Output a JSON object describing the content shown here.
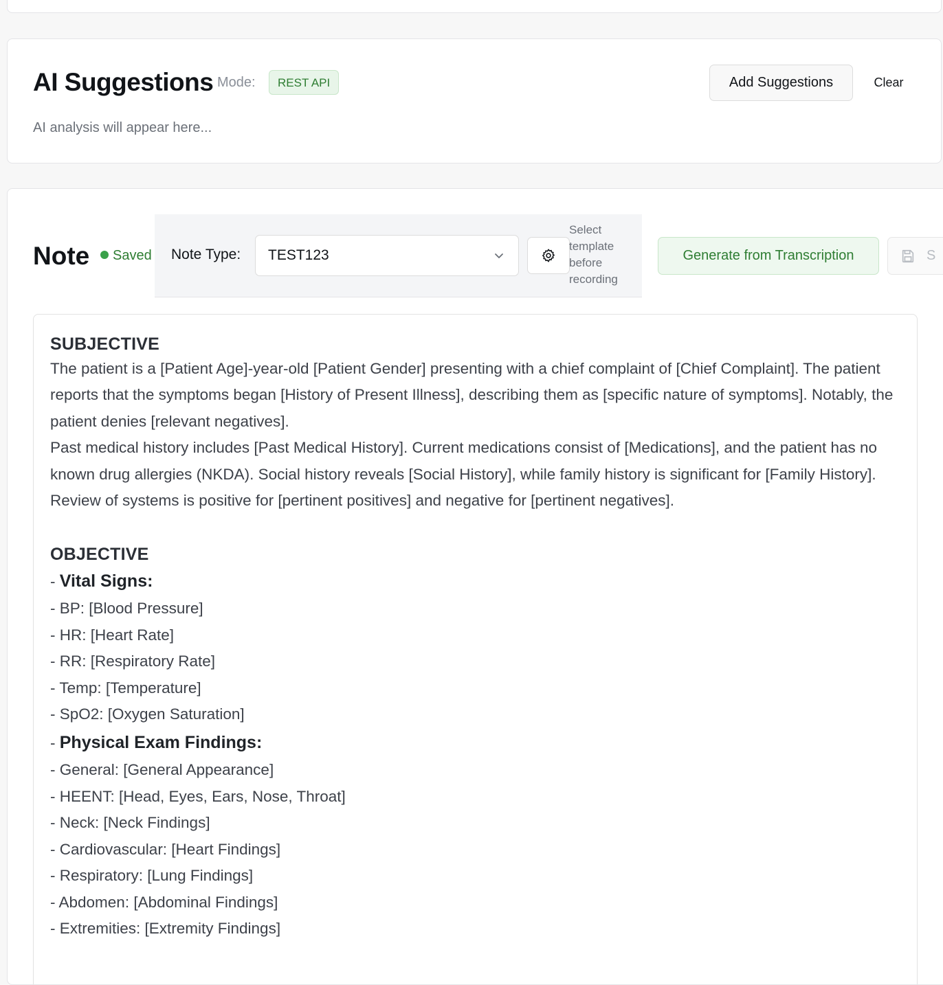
{
  "ai_panel": {
    "title": "AI Suggestions",
    "mode_label": "Mode:",
    "mode_value": "REST API",
    "add_button": "Add Suggestions",
    "clear_button": "Clear",
    "placeholder": "AI analysis will appear here..."
  },
  "note": {
    "title": "Note",
    "status": "Saved",
    "type_label": "Note Type:",
    "type_value": "TEST123",
    "hint": "Select template before recording",
    "generate_button": "Generate from Transcription",
    "save_button_partial": "S"
  },
  "content": {
    "subjective_heading": "SUBJECTIVE",
    "subjective_paragraphs": [
      "The patient is a [Patient Age]-year-old [Patient Gender] presenting with a chief complaint of [Chief Complaint]. The patient reports that the symptoms began [History of Present Illness], describing them as [specific nature of symptoms]. Notably, the patient denies [relevant negatives].",
      "Past medical history includes [Past Medical History]. Current medications consist of [Medications], and the patient has no known drug allergies (NKDA). Social history reveals [Social History], while family history is significant for [Family History].",
      "Review of systems is positive for [pertinent positives] and negative for [pertinent negatives]."
    ],
    "objective_heading": "OBJECTIVE",
    "dash": "- ",
    "vitals_heading": "Vital Signs:",
    "vitals": [
      "- BP: [Blood Pressure]",
      "- HR: [Heart Rate]",
      "- RR: [Respiratory Rate]",
      "- Temp: [Temperature]",
      "- SpO2: [Oxygen Saturation]"
    ],
    "exam_heading": "Physical Exam Findings:",
    "exam": [
      "- General: [General Appearance]",
      "- HEENT: [Head, Eyes, Ears, Nose, Throat]",
      "- Neck: [Neck Findings]",
      "- Cardiovascular: [Heart Findings]",
      "- Respiratory: [Lung Findings]",
      "- Abdomen: [Abdominal Findings]",
      "- Extremities: [Extremity Findings]"
    ]
  },
  "colors": {
    "accent_green": "#2e7d32",
    "badge_bg": "#e8f5e9",
    "background": "#f7f7f7"
  },
  "icons": {
    "settings": "gear-icon",
    "dropdown": "chevron-down-icon",
    "save": "save-icon",
    "status": "status-dot-icon"
  }
}
